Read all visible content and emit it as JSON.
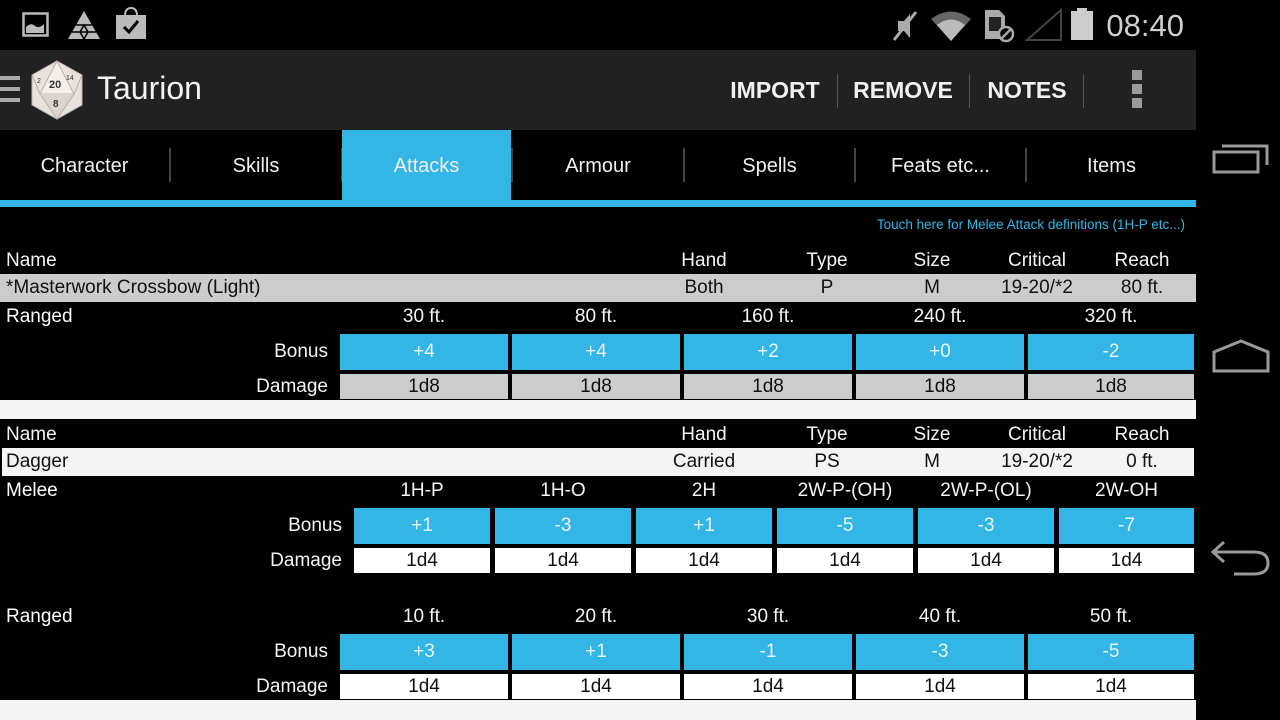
{
  "status_bar": {
    "left_icons": [
      "image-icon",
      "triangles-app-icon",
      "shopping-bag-check-icon"
    ],
    "right_icons": [
      "mute-icon",
      "wifi-icon",
      "sd-card-blocked-icon",
      "signal-empty-icon",
      "battery-icon"
    ],
    "time": "08:40"
  },
  "action_bar": {
    "app_icon": "d20-dice-icon",
    "title": "Taurion",
    "buttons": [
      "IMPORT",
      "REMOVE",
      "NOTES"
    ],
    "overflow_icon": "overflow-menu-icon"
  },
  "tabs": [
    {
      "label": "Character",
      "active": false
    },
    {
      "label": "Skills",
      "active": false
    },
    {
      "label": "Attacks",
      "active": true
    },
    {
      "label": "Armour",
      "active": false
    },
    {
      "label": "Spells",
      "active": false
    },
    {
      "label": "Feats etc...",
      "active": false
    },
    {
      "label": "Items",
      "active": false
    }
  ],
  "accent_color": "#33b5e5",
  "definitions_link": "Touch here for Melee Attack definitions (1H-P etc...)",
  "columns": {
    "name": "Name",
    "hand": "Hand",
    "type": "Type",
    "size": "Size",
    "critical": "Critical",
    "reach": "Reach"
  },
  "row_labels": {
    "bonus": "Bonus",
    "damage": "Damage"
  },
  "weapons": [
    {
      "name": "*Masterwork Crossbow (Light)",
      "hand": "Both",
      "type": "P",
      "size": "M",
      "critical": "19-20/*2",
      "reach": "80 ft.",
      "ranged": {
        "label": "Ranged",
        "ranges": [
          "30 ft.",
          "80 ft.",
          "160 ft.",
          "240 ft.",
          "320 ft."
        ],
        "bonus": [
          "+4",
          "+4",
          "+2",
          "+0",
          "-2"
        ],
        "damage": [
          "1d8",
          "1d8",
          "1d8",
          "1d8",
          "1d8"
        ]
      }
    },
    {
      "name": "Dagger",
      "hand": "Carried",
      "type": "PS",
      "size": "M",
      "critical": "19-20/*2",
      "reach": "0 ft.",
      "melee": {
        "label": "Melee",
        "modes": [
          "1H-P",
          "1H-O",
          "2H",
          "2W-P-(OH)",
          "2W-P-(OL)",
          "2W-OH"
        ],
        "bonus": [
          "+1",
          "-3",
          "+1",
          "-5",
          "-3",
          "-7"
        ],
        "damage": [
          "1d4",
          "1d4",
          "1d4",
          "1d4",
          "1d4",
          "1d4"
        ]
      },
      "ranged": {
        "label": "Ranged",
        "ranges": [
          "10 ft.",
          "20 ft.",
          "30 ft.",
          "40 ft.",
          "50 ft."
        ],
        "bonus": [
          "+3",
          "+1",
          "-1",
          "-3",
          "-5"
        ],
        "damage": [
          "1d4",
          "1d4",
          "1d4",
          "1d4",
          "1d4"
        ]
      }
    }
  ],
  "nav_bar": {
    "icons": [
      "recent-apps-icon",
      "home-icon",
      "back-icon"
    ]
  }
}
